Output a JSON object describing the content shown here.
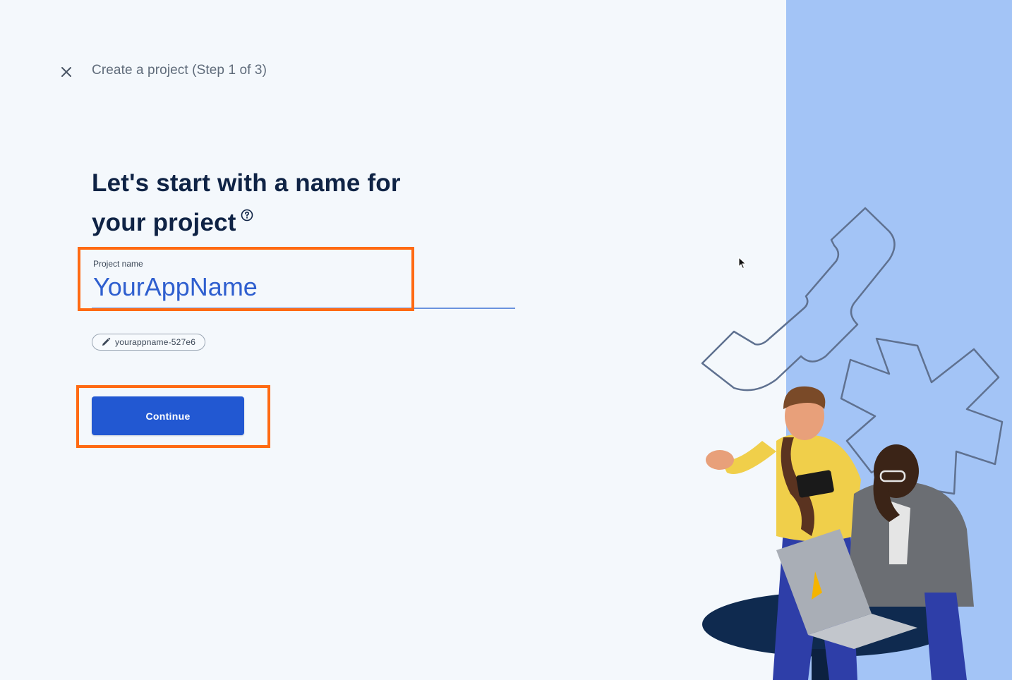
{
  "header": {
    "step_title": "Create a project (Step 1 of 3)",
    "close_icon": "close-icon"
  },
  "main": {
    "heading": "Let's start with a name for your project",
    "help_icon": "help-circle-icon",
    "project_name_field": {
      "label": "Project name",
      "value": "YourAppName"
    },
    "project_id_chip": {
      "icon": "pencil-icon",
      "value": "yourappname-527e6"
    },
    "continue_label": "Continue"
  },
  "colors": {
    "accent": "#2258d2",
    "input_text": "#2f5fcf",
    "side_panel": "#a3c4f6",
    "highlight": "#ff6a13",
    "heading": "#0f2345"
  }
}
